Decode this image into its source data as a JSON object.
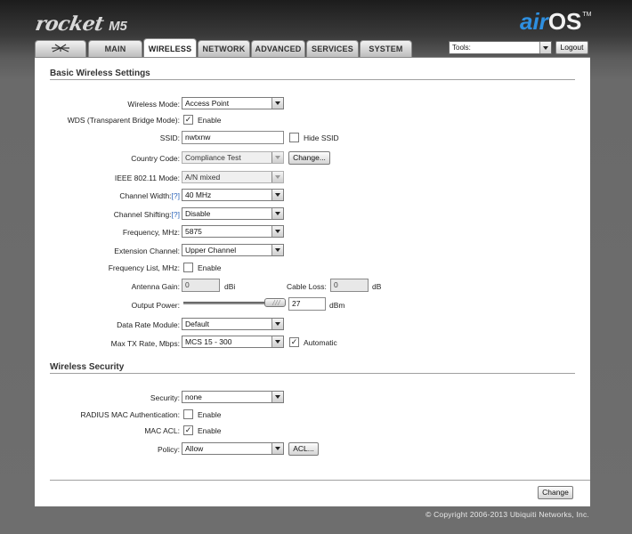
{
  "header": {
    "product_name": "rocket",
    "product_model": "M5",
    "os_logo_air": "air",
    "os_logo_os": "OS",
    "os_logo_tm": "TM",
    "accent_color": "#2e8fe0"
  },
  "tabs": [
    {
      "label": "",
      "icon": "ubiquiti-logo-icon"
    },
    {
      "label": "MAIN"
    },
    {
      "label": "WIRELESS",
      "active": true
    },
    {
      "label": "NETWORK"
    },
    {
      "label": "ADVANCED"
    },
    {
      "label": "SERVICES"
    },
    {
      "label": "SYSTEM"
    }
  ],
  "tools": {
    "selected": "Tools:",
    "logout_label": "Logout"
  },
  "basic": {
    "title": "Basic Wireless Settings",
    "wireless_mode": {
      "label": "Wireless Mode:",
      "value": "Access Point"
    },
    "wds": {
      "label": "WDS (Transparent Bridge Mode):",
      "checked": true,
      "check_label": "Enable"
    },
    "ssid": {
      "label": "SSID:",
      "value": "nwtxnw",
      "hide_label": "Hide SSID",
      "hide_checked": false
    },
    "country": {
      "label": "Country Code:",
      "value": "Compliance Test",
      "change_label": "Change..."
    },
    "ieee_mode": {
      "label": "IEEE 802.11 Mode:",
      "value": "A/N mixed"
    },
    "channel_width": {
      "label": "Channel Width:",
      "help": "[?]",
      "value": "40 MHz"
    },
    "channel_shifting": {
      "label": "Channel Shifting:",
      "help": "[?]",
      "value": "Disable"
    },
    "frequency": {
      "label": "Frequency, MHz:",
      "value": "5875"
    },
    "extension_channel": {
      "label": "Extension Channel:",
      "value": "Upper Channel"
    },
    "frequency_list": {
      "label": "Frequency List, MHz:",
      "checked": false,
      "check_label": "Enable"
    },
    "antenna_gain": {
      "label": "Antenna Gain:",
      "value": "0",
      "unit": "dBi"
    },
    "cable_loss": {
      "label": "Cable Loss:",
      "value": "0",
      "unit": "dB"
    },
    "output_power": {
      "label": "Output Power:",
      "value": "27",
      "unit": "dBm",
      "slider_fraction": 1.0
    },
    "data_rate_module": {
      "label": "Data Rate Module:",
      "value": "Default"
    },
    "max_tx_rate": {
      "label": "Max TX Rate, Mbps:",
      "value": "MCS 15 - 300",
      "auto_label": "Automatic",
      "auto_checked": true
    }
  },
  "security": {
    "title": "Wireless Security",
    "security": {
      "label": "Security:",
      "value": "none"
    },
    "radius_mac": {
      "label": "RADIUS MAC Authentication:",
      "checked": false,
      "check_label": "Enable"
    },
    "mac_acl": {
      "label": "MAC ACL:",
      "checked": true,
      "check_label": "Enable"
    },
    "policy": {
      "label": "Policy:",
      "value": "Allow",
      "acl_label": "ACL..."
    }
  },
  "footer": {
    "change_label": "Change",
    "copyright": "© Copyright 2006-2013 Ubiquiti Networks, Inc."
  }
}
